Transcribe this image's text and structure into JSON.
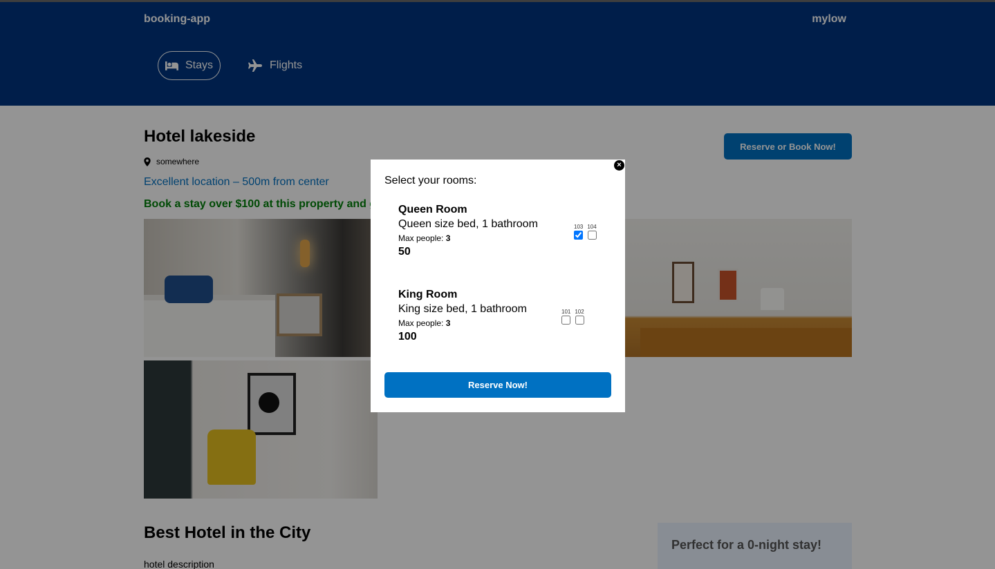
{
  "header": {
    "logo": "booking-app",
    "user": "mylow",
    "nav": [
      {
        "label": "Stays",
        "icon": "bed-icon",
        "active": true
      },
      {
        "label": "Flights",
        "icon": "plane-icon",
        "active": false
      }
    ]
  },
  "hotel": {
    "name": "Hotel lakeside",
    "address": "somewhere",
    "distance": "Excellent location – 500m from center",
    "price_highlight": "Book a stay over $100 at this property and g",
    "book_button": "Reserve or Book Now!",
    "description_title": "Best Hotel in the City",
    "description": "hotel description",
    "side_title": "Perfect for a 0-night stay!"
  },
  "modal": {
    "title": "Select your rooms:",
    "close": "×",
    "rooms": [
      {
        "name": "Queen Room",
        "desc": "Queen size bed, 1 bathroom",
        "max_label": "Max people: ",
        "max_people": "3",
        "price": "50",
        "numbers": [
          {
            "number": "103",
            "checked": true
          },
          {
            "number": "104",
            "checked": false
          }
        ]
      },
      {
        "name": "King Room",
        "desc": "King size bed, 1 bathroom",
        "max_label": "Max people: ",
        "max_people": "3",
        "price": "100",
        "numbers": [
          {
            "number": "101",
            "checked": false
          },
          {
            "number": "102",
            "checked": false
          }
        ]
      }
    ],
    "reserve_button": "Reserve Now!"
  },
  "colors": {
    "header_bg": "#003580",
    "primary": "#0071c2",
    "green": "#008009"
  }
}
